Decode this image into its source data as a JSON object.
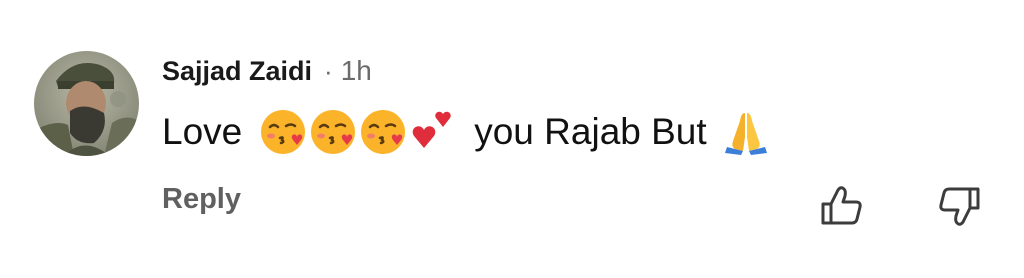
{
  "comment": {
    "author": "Sajjad Zaidi",
    "separator": "·",
    "time": "1h",
    "text_before": "Love",
    "emojis": [
      "face-blowing-kiss-emoji",
      "face-blowing-kiss-emoji",
      "face-blowing-kiss-emoji",
      "two-hearts-emoji"
    ],
    "text_after": "you Rajab But",
    "end_emoji": "folded-hands-emoji"
  },
  "actions": {
    "reply_label": "Reply",
    "like_icon": "thumbs-up-icon",
    "dislike_icon": "thumbs-down-icon"
  },
  "colors": {
    "author": "#1a1a1a",
    "meta": "#6b6b6b",
    "body_text": "#111111",
    "reply": "#606060",
    "icon_stroke": "#3c3c3c"
  }
}
